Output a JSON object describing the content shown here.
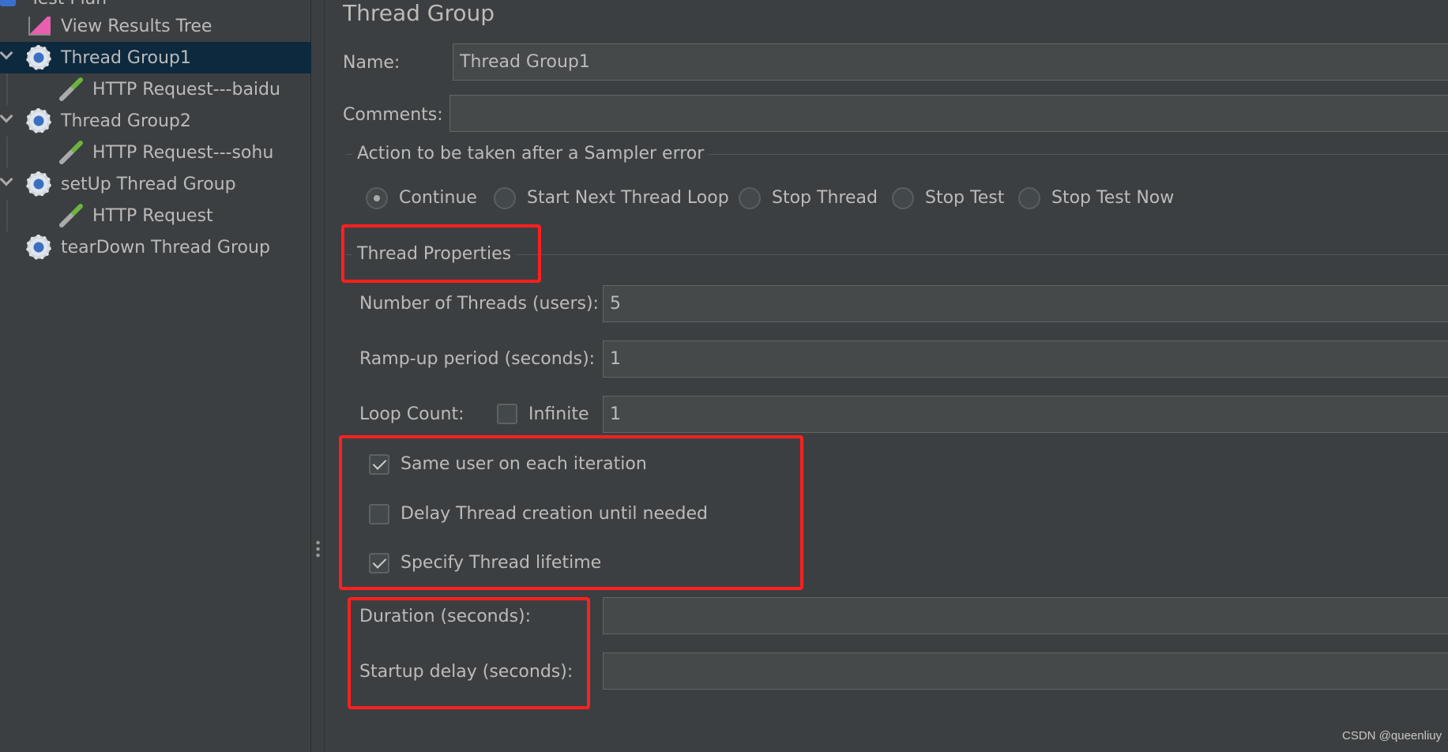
{
  "tree": {
    "items": [
      {
        "label": "Test Plan",
        "icon": "test-plan-icon"
      },
      {
        "label": "View Results Tree",
        "icon": "chart-icon"
      },
      {
        "label": "Thread Group1",
        "icon": "gear-icon",
        "selected": true
      },
      {
        "label": "HTTP Request---baidu",
        "icon": "pipette-icon"
      },
      {
        "label": "Thread Group2",
        "icon": "gear-icon"
      },
      {
        "label": "HTTP Request---sohu",
        "icon": "pipette-icon"
      },
      {
        "label": "setUp Thread Group",
        "icon": "gear-icon"
      },
      {
        "label": "HTTP Request",
        "icon": "pipette-icon"
      },
      {
        "label": "tearDown Thread Group",
        "icon": "gear-icon"
      }
    ]
  },
  "panel": {
    "title": "Thread Group",
    "name_label": "Name:",
    "name_value": "Thread Group1",
    "comments_label": "Comments:",
    "comments_value": "",
    "action_title": "Action to be taken after a Sampler error",
    "actions": [
      {
        "label": "Continue",
        "selected": true
      },
      {
        "label": "Start Next Thread Loop",
        "selected": false
      },
      {
        "label": "Stop Thread",
        "selected": false
      },
      {
        "label": "Stop Test",
        "selected": false
      },
      {
        "label": "Stop Test Now",
        "selected": false
      }
    ],
    "props_title": "Thread Properties",
    "threads_label": "Number of Threads (users):",
    "threads_value": "5",
    "rampup_label": "Ramp-up period (seconds):",
    "rampup_value": "1",
    "loop_label": "Loop Count:",
    "infinite_label": "Infinite",
    "infinite_checked": false,
    "loop_value": "1",
    "same_user_label": "Same user on each iteration",
    "same_user_checked": true,
    "delay_label": "Delay Thread creation until needed",
    "delay_checked": false,
    "lifetime_label": "Specify Thread lifetime",
    "lifetime_checked": true,
    "duration_label": "Duration (seconds):",
    "duration_value": "",
    "startup_label": "Startup delay (seconds):",
    "startup_value": ""
  },
  "watermark": "CSDN @queenliuy",
  "colors": {
    "background": "#3c3f41",
    "selection": "#0d293e",
    "highlight": "#ff2020"
  }
}
